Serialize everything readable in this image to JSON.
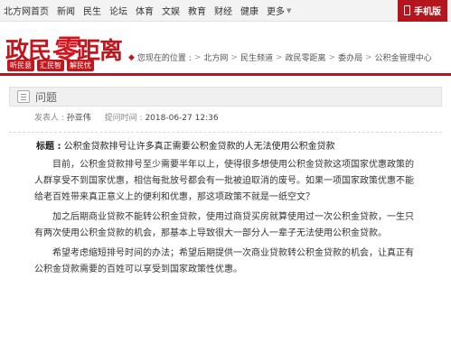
{
  "topnav": {
    "items": [
      "北方网首页",
      "新闻",
      "民生",
      "论坛",
      "体育",
      "文娱",
      "教育",
      "财经",
      "健康"
    ],
    "more": "更多",
    "mobile": "手机版"
  },
  "header": {
    "logo_part1": "政民",
    "logo_zero": "零",
    "logo_part2": "距离",
    "slogans": [
      "听民意",
      "汇民智",
      "解民忧"
    ]
  },
  "breadcrumb": {
    "prefix": "您现在的位置 :",
    "items": [
      "北方网",
      "民生频道",
      "政民零距离",
      "委办局",
      "公积金管理中心"
    ]
  },
  "question": {
    "header": "问题",
    "author_label": "发表人 :",
    "author": "孙亚伟",
    "time_label": "提问时间 :",
    "time": "2018-06-27 12:36",
    "title_label": "标题 :",
    "title": "公积金贷款排号让许多真正需要公积金贷款的人无法使用公积金贷款",
    "paragraphs": [
      "目前，公积金贷款排号至少需要半年以上，使得很多想使用公积金贷款这项国家优惠政策的人群享受不到国家优惠，相信每批放号都会有一批被迫取消的废号。如果一项国家政策优惠不能给老百姓带来真正意义上的便利和优惠，那这项政策不就是一纸空文？",
      "加之后期商业贷款不能转公积金贷款，使用过商贷买房就算使用过一次公积金贷款，一生只有两次使用公积金贷款的机会，那基本上导致很大一部分人一辈子无法使用公积金贷款。",
      "希望考虑缩短排号时间的办法；希望后期提供一次商业贷款转公积金贷款的机会，让真正有公积金贷款需要的百姓可以享受到国家政策性优惠。"
    ]
  }
}
